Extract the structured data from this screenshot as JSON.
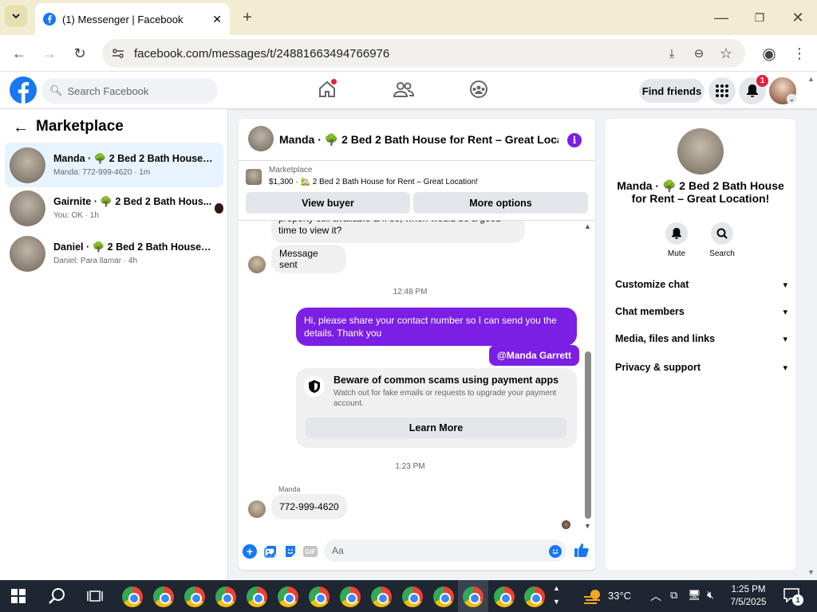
{
  "browser": {
    "tab_title": "(1) Messenger | Facebook",
    "url": "facebook.com/messages/t/24881663494766976"
  },
  "fb_header": {
    "search_placeholder": "Search Facebook",
    "find_friends": "Find friends",
    "notification_count": "1"
  },
  "left": {
    "title": "Marketplace",
    "conversations": [
      {
        "name": "Manda · 🌳 2 Bed 2 Bath House fo...",
        "sub": "Manda: 772-999-4620 · 1m"
      },
      {
        "name": "Gairnite · 🌳 2 Bed 2 Bath Hous...",
        "sub": "You: OK · 1h"
      },
      {
        "name": "Daniel · 🌳 2 Bed 2 Bath House for...",
        "sub": "Daniel: Para llamar · 4h"
      }
    ]
  },
  "chat": {
    "header_title": "Manda · 🌳 2 Bed 2 Bath House for Rent – Great Locati...",
    "listing_category": "Marketplace",
    "listing_price": "$1,300 · 🏡 2 Bed 2 Bath House for Rent – Great Location!",
    "view_buyer": "View buyer",
    "more_options": "More options",
    "partial_message": "property still available & if so, when would be a good time to view it?",
    "message_sent": "Message sent",
    "time1": "12:48 PM",
    "outgoing_message": "Hi, please share your contact number so I can send you the details. Thank you",
    "mention": "@Manda Garrett",
    "warning_title": "Beware of common scams using payment apps",
    "warning_body": "Watch out for fake emails or requests to upgrade your payment account.",
    "learn_more": "Learn More",
    "time2": "1:23 PM",
    "sender_name": "Manda",
    "incoming_message": "772-999-4620",
    "input_placeholder": "Aa"
  },
  "right": {
    "title": "Manda · 🌳 2 Bed 2 Bath House for Rent – Great Location!",
    "mute": "Mute",
    "search": "Search",
    "links": [
      "Customize chat",
      "Chat members",
      "Media, files and links",
      "Privacy & support"
    ]
  },
  "taskbar": {
    "temperature": "33°C",
    "time": "1:25 PM",
    "date": "7/5/2025",
    "notification_count": "1"
  },
  "colors": {
    "fb_blue": "#1877f2",
    "messenger_purple": "#7b1fe4",
    "active_row": "#e7f3ff"
  }
}
